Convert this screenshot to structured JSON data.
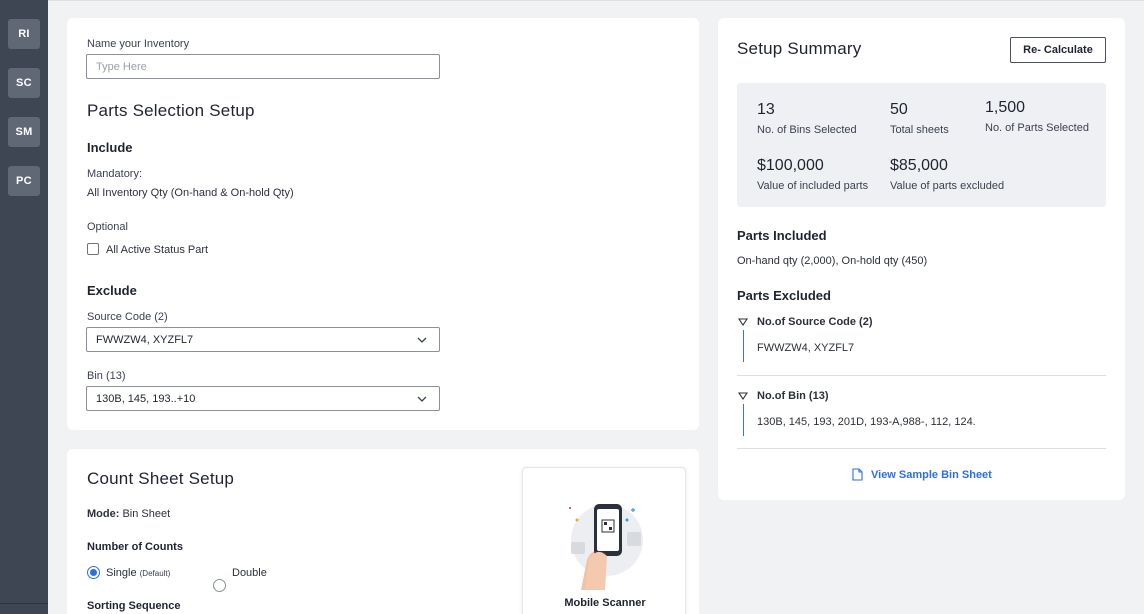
{
  "rail": {
    "items": [
      {
        "label": "RI"
      },
      {
        "label": "SC"
      },
      {
        "label": "SM"
      },
      {
        "label": "PC"
      }
    ]
  },
  "parts_setup": {
    "name_label": "Name your Inventory",
    "name_placeholder": "Type Here",
    "title": "Parts Selection Setup",
    "include_heading": "Include",
    "mandatory_label": "Mandatory:",
    "mandatory_value": "All Inventory Qty (On-hand & On-hold Qty)",
    "optional_label": "Optional",
    "optional_checkbox_label": "All Active Status Part",
    "optional_checked": false,
    "exclude_heading": "Exclude",
    "source_code_label": "Source Code (2)",
    "source_code_value": "FWWZW4, XYZFL7",
    "bin_label": "Bin (13)",
    "bin_value": "130B, 145, 193..+10"
  },
  "count_setup": {
    "title": "Count Sheet Setup",
    "mode_label": "Mode:",
    "mode_value": "Bin Sheet",
    "counts_label": "Number of Counts",
    "option_single": "Single",
    "option_single_note": "(Default)",
    "option_double": "Double",
    "selected": "Single",
    "sorting_label": "Sorting Sequence",
    "scanner_label": "Mobile Scanner"
  },
  "summary": {
    "title": "Setup Summary",
    "recalc_label": "Re- Calculate",
    "stats": {
      "bins_value": "13",
      "bins_label": "No. of Bins Selected",
      "sheets_value": "50",
      "sheets_label": "Total sheets",
      "parts_value": "1,500",
      "parts_label": "No. of Parts Selected",
      "included_value": "$100,000",
      "included_label": "Value of included parts",
      "excluded_value": "$85,000",
      "excluded_label": "Value of parts excluded"
    },
    "included_heading": "Parts Included",
    "included_text": "On-hand qty (2,000), On-hold qty (450)",
    "excluded_heading": "Parts Excluded",
    "source_code_heading": "No.of Source Code (2)",
    "source_code_list": "FWWZW4, XYZFL7",
    "bin_heading": "No.of Bin (13)",
    "bin_list": "130B, 145, 193, 201D, 193-A,988-, 112, 124.",
    "view_sample_label": "View Sample Bin Sheet"
  },
  "colors": {
    "accent": "#2d6fe0",
    "rail_bg": "#3f4653",
    "page_bg": "#f1f2f4"
  }
}
